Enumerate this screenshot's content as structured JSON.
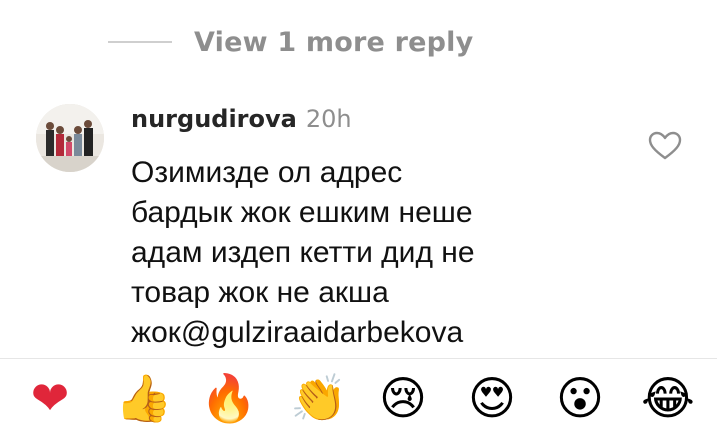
{
  "replies": {
    "view_more_label": "View 1 more reply"
  },
  "comment": {
    "username": "nurgudirova",
    "time": "20h",
    "lines": [
      "Озимизде ол адрес",
      "бардык жок ешким неше",
      "адам издеп кетти дид не",
      "товар жок не акша",
      "жок@gulziraaidarbekova"
    ],
    "like_icon": "heart-outline-icon"
  },
  "emoji_bar": {
    "emojis": [
      "❤",
      "👍",
      "🔥",
      "👏",
      "😢",
      "😍",
      "😮",
      "😂"
    ]
  },
  "colors": {
    "secondary_text": "#8e8e8e",
    "primary_text": "#262626",
    "divider": "#e6e6e6"
  }
}
